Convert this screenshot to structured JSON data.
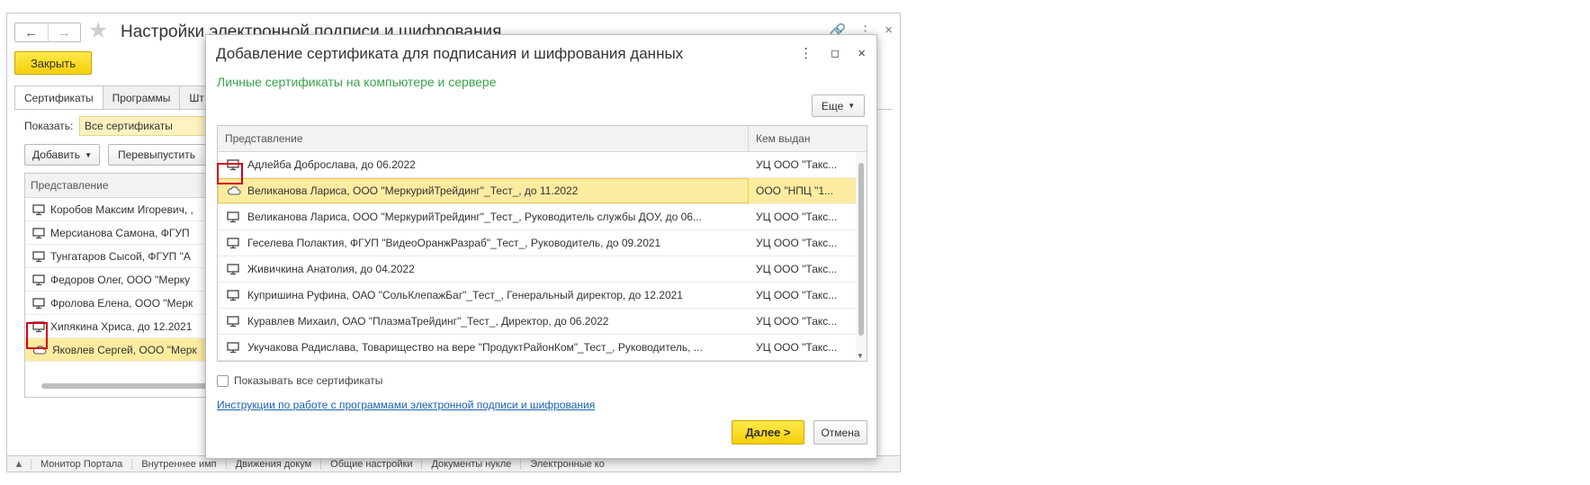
{
  "background": {
    "title": "Настройки электронной подписи и шифрования",
    "close_label": "Закрыть",
    "tabs": [
      {
        "label": "Сертификаты"
      },
      {
        "label": "Программы"
      },
      {
        "label": "Шт"
      }
    ],
    "show_label": "Показать:",
    "show_value": "Все сертификаты",
    "add_label": "Добавить",
    "reissue_label": "Перевыпустить",
    "table_header": "Представление",
    "rows": [
      {
        "icon": "computer-icon",
        "text": "Коробов Максим Игоревич, ,"
      },
      {
        "icon": "computer-icon",
        "text": "Мерсианова Самона, ФГУП"
      },
      {
        "icon": "computer-icon",
        "text": "Тунгатаров Сысой, ФГУП \"А"
      },
      {
        "icon": "computer-icon",
        "text": "Федоров Олег, ООО \"Мерку"
      },
      {
        "icon": "computer-icon",
        "text": "Фролова Елена, ООО \"Мерк"
      },
      {
        "icon": "computer-icon",
        "text": "Хипякина Хриса, до 12.2021"
      },
      {
        "icon": "cloud-icon",
        "text": "Яковлев Сергей, ООО \"Мерк"
      }
    ],
    "taskbar": [
      "Монитор Портала",
      "Внутреннее имп",
      "Движения докум",
      "Общие настройки",
      "Документы нукле",
      "Электронные ко"
    ]
  },
  "dialog": {
    "title": "Добавление сертификата для подписания и шифрования данных",
    "subtitle": "Личные сертификаты на компьютере и сервере",
    "more_label": "Еще",
    "columns": [
      "Представление",
      "Кем выдан"
    ],
    "rows": [
      {
        "icon": "computer-icon",
        "name": "Адлейба Доброслава, до 06.2022",
        "issuer": "УЦ ООО \"Такс..."
      },
      {
        "icon": "cloud-icon",
        "name": "Великанова Лариса, ООО \"МеркурийТрейдинг\"_Тест_, до 11.2022",
        "issuer": "ООО \"НПЦ \"1...",
        "selected": true
      },
      {
        "icon": "computer-icon",
        "name": "Великанова Лариса, ООО \"МеркурийТрейдинг\"_Тест_, Руководитель службы ДОУ, до 06...",
        "issuer": "УЦ ООО \"Такс..."
      },
      {
        "icon": "computer-icon",
        "name": "Геселева Полактия, ФГУП \"ВидеоОранжРазраб\"_Тест_, Руководитель, до 09.2021",
        "issuer": "УЦ ООО \"Такс..."
      },
      {
        "icon": "computer-icon",
        "name": "Живичкина Анатолия, до 04.2022",
        "issuer": "УЦ ООО \"Такс..."
      },
      {
        "icon": "computer-icon",
        "name": "Купришина Руфина, ОАО \"СольКлепажБаг\"_Тест_, Генеральный директор, до 12.2021",
        "issuer": "УЦ ООО \"Такс..."
      },
      {
        "icon": "computer-icon",
        "name": "Куравлев Михаил, ОАО \"ПлазмаТрейдинг\"_Тест_, Директор, до 06.2022",
        "issuer": "УЦ ООО \"Такс..."
      },
      {
        "icon": "computer-icon",
        "name": "Укучакова Радислава, Товарищество на вере \"ПродуктРайонКом\"_Тест_, Руководитель, ...",
        "issuer": "УЦ ООО \"Такс..."
      }
    ],
    "show_all_label": "Показывать все сертификаты",
    "show_all_checked": false,
    "instructions_link": "Инструкции по работе с программами электронной подписи и шифрования",
    "next_label": "Далее >",
    "cancel_label": "Отмена"
  },
  "colors": {
    "accent_yellow": "#f5cf0b",
    "selection": "#fdeca0",
    "subtitle_green": "#3aa54a",
    "link_blue": "#1a5fb4",
    "highlight_red": "#d3001a"
  }
}
